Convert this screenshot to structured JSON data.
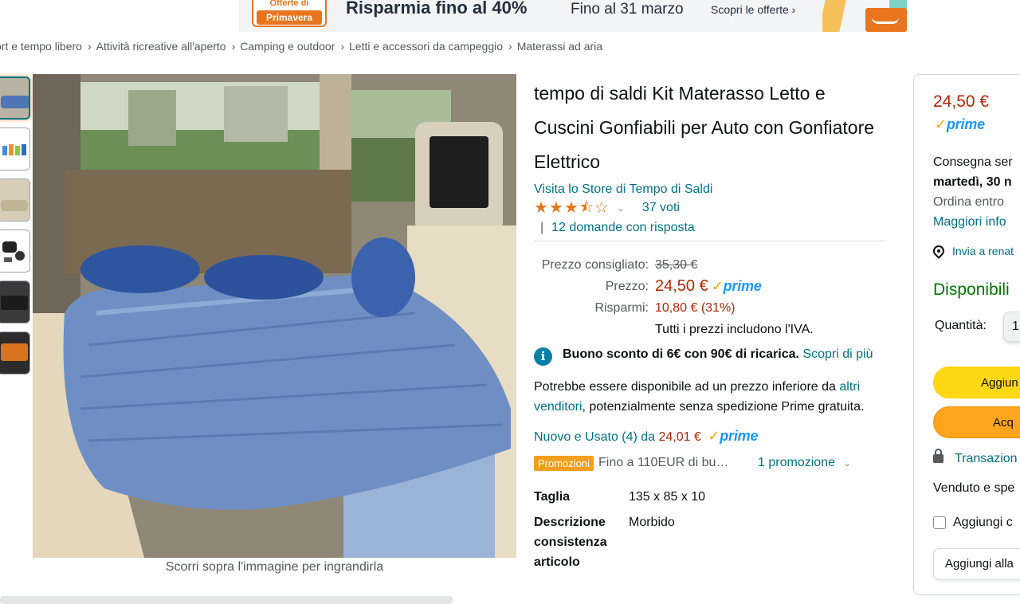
{
  "banner": {
    "badge_line1": "Offerte di",
    "badge_line2": "Primavera",
    "headline": "Risparmia fino al 40%",
    "date": "Fino al 31 marzo",
    "link": "Scopri le offerte ›"
  },
  "breadcrumb": [
    "ort e tempo libero",
    "Attività ricreative all'aperto",
    "Camping e outdoor",
    "Letti e accessori da campeggio",
    "Materassi ad aria"
  ],
  "breadcrumb_sep": "›",
  "gallery": {
    "zoom_hint": "Scorri sopra l'immagine per ingrandirla",
    "thumbnail_count": 6,
    "selected_index": 0
  },
  "product": {
    "title": "tempo di saldi Kit Materasso Letto e Cuscini Gonfiabili per Auto con Gonfiatore Elettrico",
    "store_link": "Visita lo Store di Tempo di Saldi",
    "rating": 3.5,
    "rating_max": 5,
    "votes": "37 voti",
    "qa_bar": "|",
    "qa": "12 domande con risposta"
  },
  "pricing": {
    "list_label": "Prezzo consigliato:",
    "list_price": "35,30 €",
    "price_label": "Prezzo:",
    "price": "24,50 €",
    "savings_label": "Risparmi:",
    "savings": "10,80 € (31%)",
    "vat_note": "Tutti i prezzi includono l'IVA.",
    "prime_check": "✓",
    "prime_word": "prime"
  },
  "coupon": {
    "icon": "i",
    "bold": "Buono sconto di 6€ con 90€ di ricarica.",
    "link": "Scopri di più"
  },
  "other_sellers": {
    "before": "Potrebbe essere disponibile ad un prezzo inferiore da ",
    "link": "altri venditori",
    "after": ", potenzialmente senza spedizione Prime gratuita."
  },
  "new_used": {
    "text": "Nuovo e Usato (4) da ",
    "price": "24,01 €"
  },
  "promo": {
    "badge": "Promozioni",
    "text": "Fino a 110EUR di bu…",
    "count": "1 promozione"
  },
  "specs": [
    {
      "key": "Taglia",
      "value": "135 x 85 x 10"
    },
    {
      "key": "Descrizione consistenza articolo",
      "value": "Morbido"
    }
  ],
  "buybox": {
    "price": "24,50 €",
    "delivery_line1": "Consegna ser",
    "delivery_date": "martedì, 30 n",
    "order_within": "Ordina entro",
    "more_info": "Maggiori info",
    "location": "Invia a renat",
    "availability": "Disponibili",
    "qty_label": "Quantità:",
    "qty_value": "1",
    "add_to_cart": "Aggiun",
    "buy_now": "Acq",
    "secure": "Transazion",
    "sold_by": "Venduto e spe",
    "gift_option": "Aggiungi c",
    "add_to_list": "Aggiungi alla"
  },
  "colors": {
    "accent_link": "#007185",
    "price_red": "#B12704",
    "prime_blue": "#1a98ff",
    "cart_yellow": "#FFD814",
    "buy_orange": "#FFA41C",
    "avail_green": "#007600",
    "promo_orange": "#f39f1c",
    "star_orange": "#de7921"
  },
  "icons": [
    "chevron-down-icon",
    "info-icon",
    "pin-icon",
    "lock-icon",
    "star-icon",
    "prime-check-icon"
  ]
}
